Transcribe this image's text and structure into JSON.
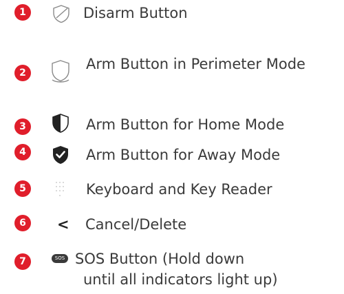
{
  "accent_color": "#e01e2b",
  "legend": [
    {
      "number": "1",
      "icon": "shield-outline-slash-icon",
      "label": "Disarm Button"
    },
    {
      "number": "2",
      "icon": "shield-outline-perimeter-icon",
      "label": "Arm Button in Perimeter Mode"
    },
    {
      "number": "3",
      "icon": "shield-half-filled-icon",
      "label": "Arm Button for Home Mode"
    },
    {
      "number": "4",
      "icon": "shield-check-filled-icon",
      "label": "Arm Button for Away Mode"
    },
    {
      "number": "5",
      "icon": "keypad-dots-icon",
      "label": "Keyboard and Key Reader"
    },
    {
      "number": "6",
      "icon": "less-than-icon",
      "glyph": "<",
      "label": "Cancel/Delete"
    },
    {
      "number": "7",
      "icon": "sos-pill-icon",
      "icon_text": "SOS",
      "label_line1": "SOS Button (Hold down",
      "label_line2": "until all indicators light up)"
    }
  ]
}
